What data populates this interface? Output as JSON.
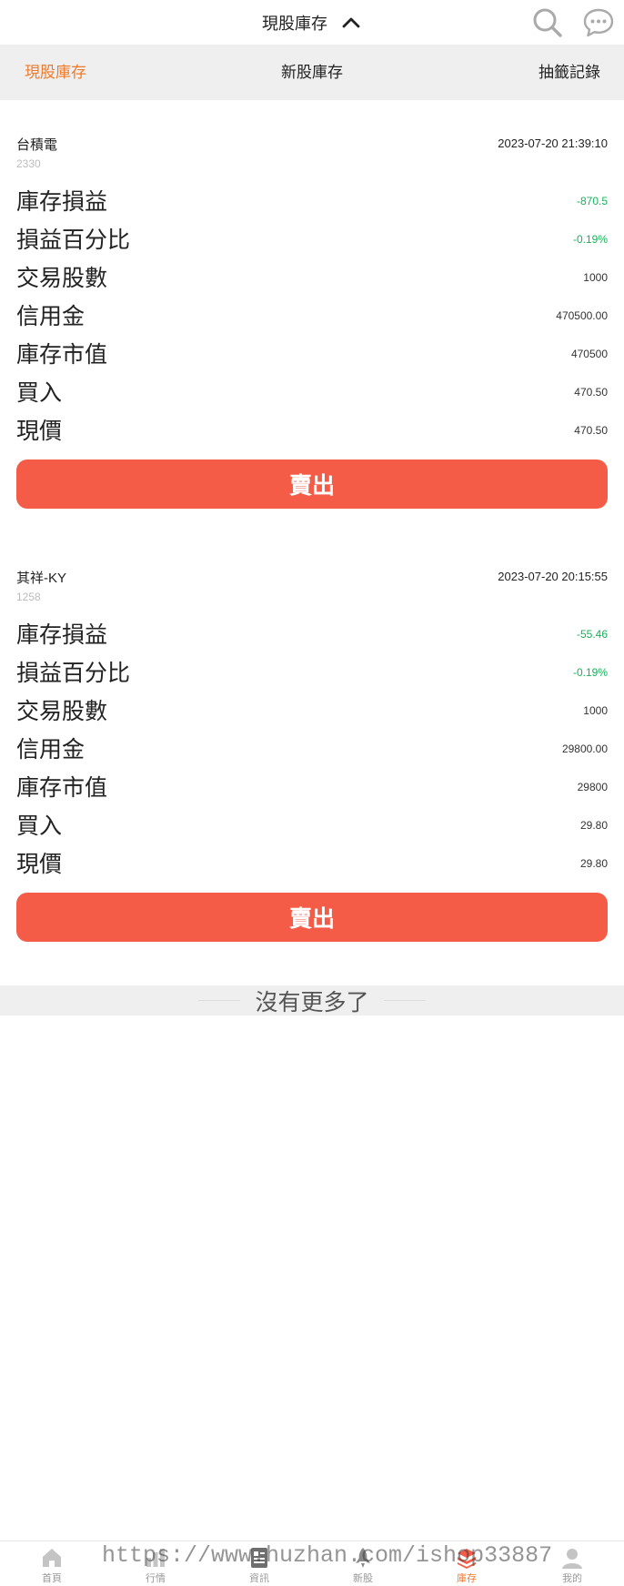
{
  "header": {
    "title": "現股庫存",
    "title_icon": "chevron-up-icon",
    "right_icons": [
      "search-icon",
      "chat-bubble-icon"
    ]
  },
  "tabs": [
    {
      "label": "現股庫存",
      "active": true
    },
    {
      "label": "新股庫存",
      "active": false
    },
    {
      "label": "抽籤記錄",
      "active": false
    }
  ],
  "holdings": [
    {
      "name": "台積電",
      "code": "2330",
      "time": "2023-07-20 21:39:10",
      "rows": [
        {
          "label": "庫存損益",
          "value": "-870.5"
        },
        {
          "label": "損益百分比",
          "value": "-0.19%"
        },
        {
          "label": "交易股數",
          "value": "1000"
        },
        {
          "label": "信用金",
          "value": "470500.00"
        },
        {
          "label": "庫存市值",
          "value": "470500"
        },
        {
          "label": "買入",
          "value": "470.50"
        },
        {
          "label": "現價",
          "value": "470.50"
        }
      ],
      "sell_label": "賣出"
    },
    {
      "name": "其祥-KY",
      "code": "1258",
      "time": "2023-07-20 20:15:55",
      "rows": [
        {
          "label": "庫存損益",
          "value": "-55.46"
        },
        {
          "label": "損益百分比",
          "value": "-0.19%"
        },
        {
          "label": "交易股數",
          "value": "1000"
        },
        {
          "label": "信用金",
          "value": "29800.00"
        },
        {
          "label": "庫存市值",
          "value": "29800"
        },
        {
          "label": "買入",
          "value": "29.80"
        },
        {
          "label": "現價",
          "value": "29.80"
        }
      ],
      "sell_label": "賣出"
    }
  ],
  "no_more_text": "沒有更多了",
  "bottom_nav": [
    {
      "label": "首頁",
      "icon": "home-icon",
      "active": false
    },
    {
      "label": "行情",
      "icon": "market-icon",
      "active": false
    },
    {
      "label": "資訊",
      "icon": "news-icon",
      "active": false
    },
    {
      "label": "新股",
      "icon": "rocket-icon",
      "active": false
    },
    {
      "label": "庫存",
      "icon": "stack-icon",
      "active": true
    },
    {
      "label": "我的",
      "icon": "user-icon",
      "active": false
    }
  ],
  "watermark": "https://www.huzhan.com/ishop33887",
  "colors": {
    "accent": "#f07a2a",
    "sell_button": "#f45c48",
    "negative_value": "#16b15a",
    "tab_bar_bg": "#efefef"
  }
}
